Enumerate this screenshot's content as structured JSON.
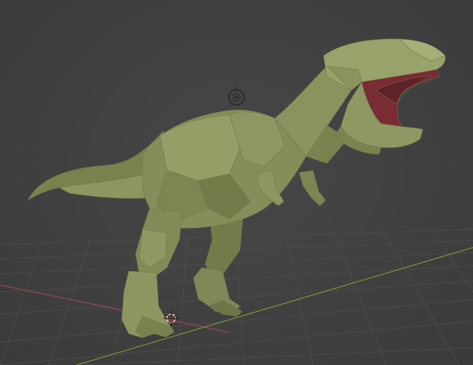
{
  "viewport": {
    "mode": "3d-viewport-solid-shading",
    "colors": {
      "background": "#3d3d3d",
      "grid_line": "#4a4a4a",
      "x_axis": "#9a4a56",
      "y_axis": "#7a9436",
      "model_base": "#828a58",
      "model_light": "#a2aa72",
      "model_shadow": "#5d6440",
      "mouth_interior": "#7a2c34"
    },
    "scene": {
      "object": "trex-model",
      "gizmos": [
        "light-object-icon",
        "3d-cursor-icon"
      ]
    }
  }
}
